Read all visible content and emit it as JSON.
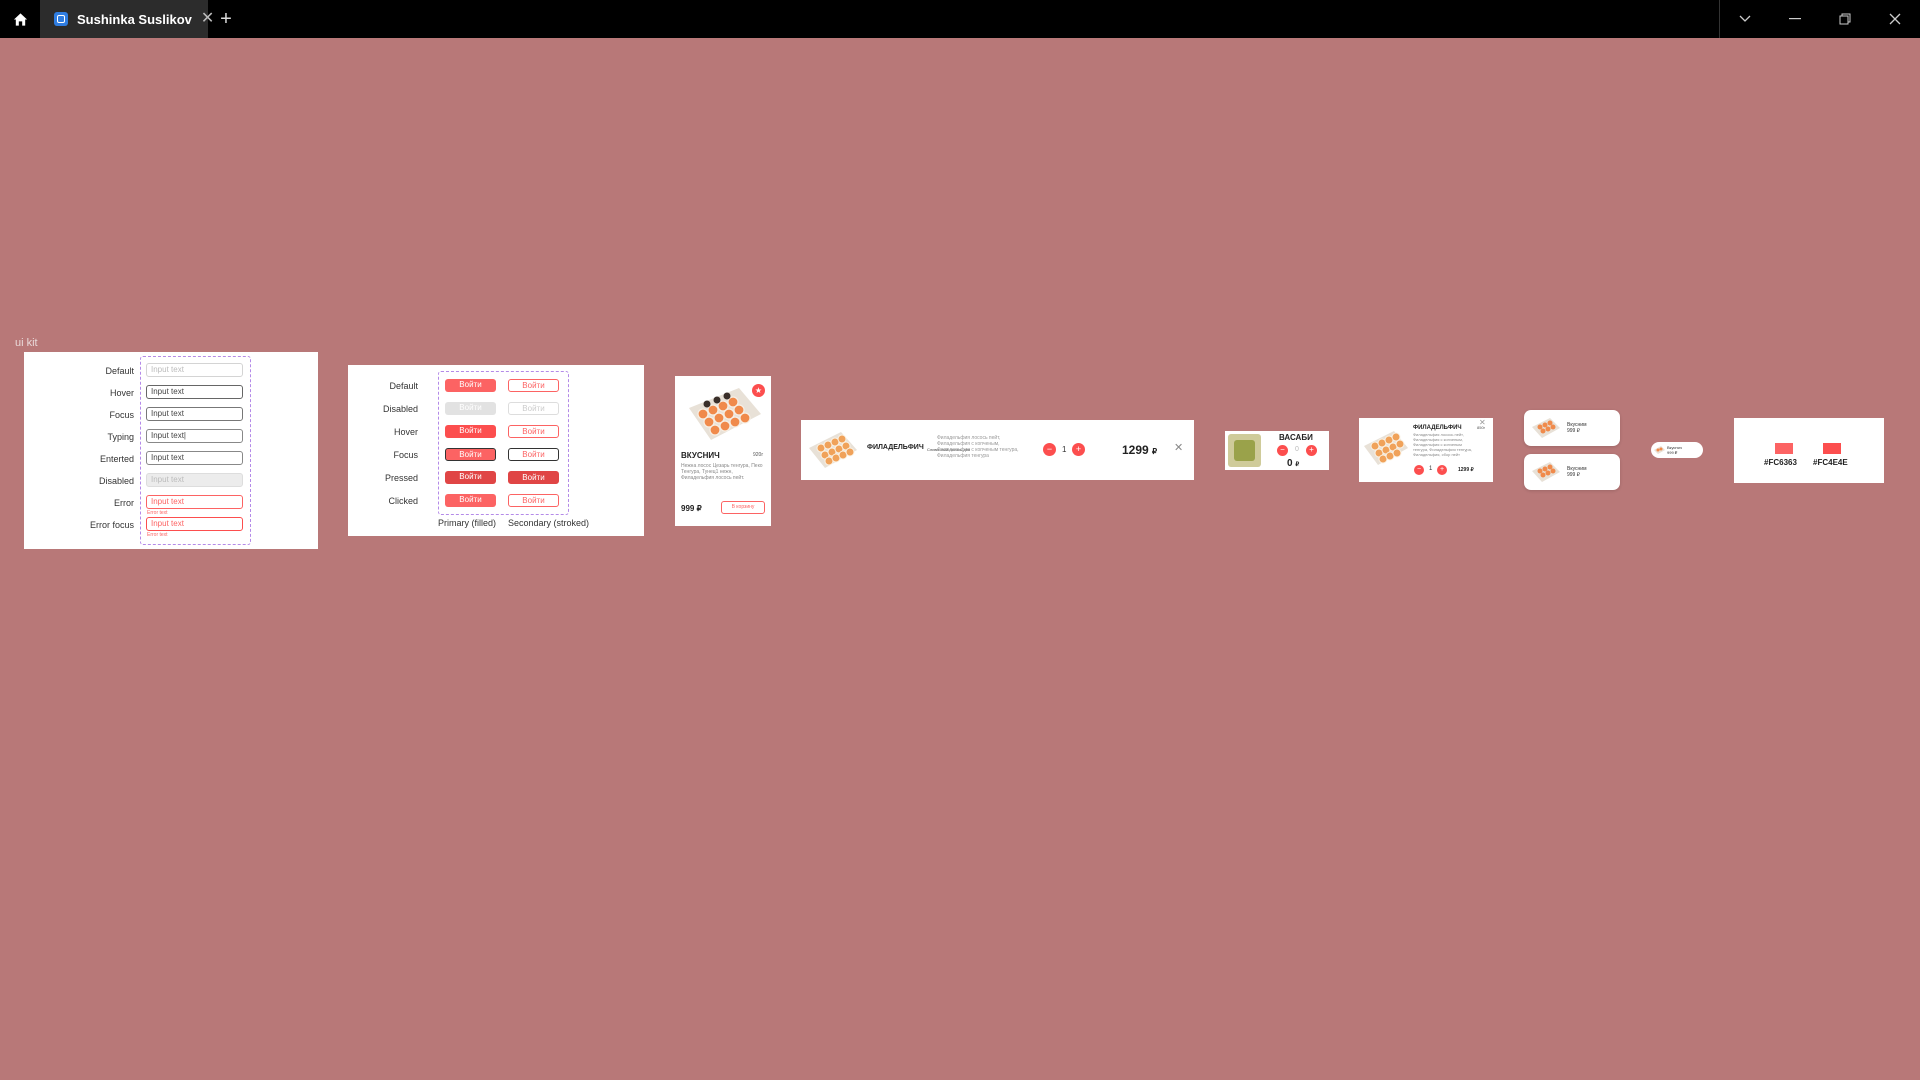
{
  "window": {
    "tab_title": "Sushinka Suslikov",
    "tab_close": "✕",
    "new_tab": "+"
  },
  "canvas": {
    "frame_label": "ui kit",
    "background": "#B87878"
  },
  "inputs_section": {
    "rows": [
      {
        "label": "Default",
        "value": "Input text"
      },
      {
        "label": "Hover",
        "value": "Input text"
      },
      {
        "label": "Focus",
        "value": "Input text"
      },
      {
        "label": "Typing",
        "value": "Input text|"
      },
      {
        "label": "Enterted",
        "value": "Input text"
      },
      {
        "label": "Disabled",
        "value": "Input text"
      },
      {
        "label": "Error",
        "value": "Input text"
      },
      {
        "label": "Error focus",
        "value": "Input text"
      }
    ],
    "error_hint": "Error text"
  },
  "buttons_section": {
    "rows": [
      {
        "label": "Default",
        "primary": "Войти",
        "secondary": "Войти"
      },
      {
        "label": "Disabled",
        "primary": "Войти",
        "secondary": "Войти"
      },
      {
        "label": "Hover",
        "primary": "Войти",
        "secondary": "Войти"
      },
      {
        "label": "Focus",
        "primary": "Войти",
        "secondary": "Войти"
      },
      {
        "label": "Pressed",
        "primary": "Войти",
        "secondary": "Войти"
      },
      {
        "label": "Clicked",
        "primary": "Войти",
        "secondary": "Войти"
      }
    ],
    "primary_caption": "Primary (filled)",
    "secondary_caption": "Secondary (stroked)"
  },
  "product_card": {
    "title": "ВКУСНИЧ",
    "weight": "920г",
    "description": "Нежна лосос Цезарь тенгура, Пеко Тенгура, Тунец1 нежн, Филадельфия лосось пейт.",
    "price": "999 ₽",
    "button": "В корзину",
    "favorite_icon": "star-icon"
  },
  "cart_row": {
    "name": "ФИЛАДЕЛЬФИЧ",
    "subtitle": "Сливочный лосось для",
    "description": "Филадельфия лосось пейт, Филадельфия с копченым, Филадельфия с копченым тенгура, Филадельфия тенгура",
    "quantity": "1",
    "price": "1299",
    "currency": "₽",
    "minus": "−",
    "plus": "+",
    "remove": "✕"
  },
  "wasabi": {
    "name": "ВАСАБИ",
    "quantity": "0",
    "price": "0",
    "currency": "₽",
    "minus": "−",
    "plus": "+"
  },
  "mini_cart": {
    "name": "ФИЛАДЕЛЬФИЧ",
    "weight": "850г",
    "description": "Филадельфия лосось пейт, Филадельфия с копченым, Филадельфия с копченым тенгура, Филадельфия тенгура, Филадельфия, сбор пейт",
    "quantity": "1",
    "price": "1299 ₽",
    "minus": "−",
    "plus": "+",
    "remove": "✕"
  },
  "list_items": [
    {
      "name": "Вкусним",
      "price": "999 ₽"
    },
    {
      "name": "Вкусним",
      "price": "999 ₽"
    }
  ],
  "pill": {
    "name": "Вкуснич",
    "price": "999 ₽"
  },
  "colors": [
    {
      "hex": "#FC6363",
      "label": "#FC6363"
    },
    {
      "hex": "#FC4E4E",
      "label": "#FC4E4E"
    }
  ]
}
